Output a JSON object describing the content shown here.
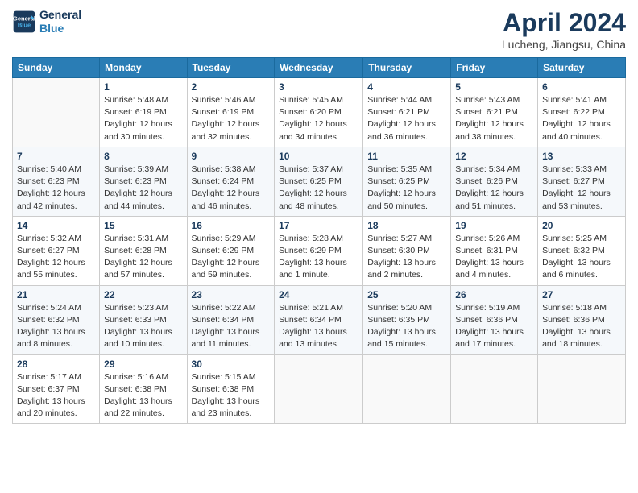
{
  "header": {
    "logo_line1": "General",
    "logo_line2": "Blue",
    "title": "April 2024",
    "subtitle": "Lucheng, Jiangsu, China"
  },
  "columns": [
    "Sunday",
    "Monday",
    "Tuesday",
    "Wednesday",
    "Thursday",
    "Friday",
    "Saturday"
  ],
  "weeks": [
    [
      {
        "num": "",
        "info": ""
      },
      {
        "num": "1",
        "info": "Sunrise: 5:48 AM\nSunset: 6:19 PM\nDaylight: 12 hours\nand 30 minutes."
      },
      {
        "num": "2",
        "info": "Sunrise: 5:46 AM\nSunset: 6:19 PM\nDaylight: 12 hours\nand 32 minutes."
      },
      {
        "num": "3",
        "info": "Sunrise: 5:45 AM\nSunset: 6:20 PM\nDaylight: 12 hours\nand 34 minutes."
      },
      {
        "num": "4",
        "info": "Sunrise: 5:44 AM\nSunset: 6:21 PM\nDaylight: 12 hours\nand 36 minutes."
      },
      {
        "num": "5",
        "info": "Sunrise: 5:43 AM\nSunset: 6:21 PM\nDaylight: 12 hours\nand 38 minutes."
      },
      {
        "num": "6",
        "info": "Sunrise: 5:41 AM\nSunset: 6:22 PM\nDaylight: 12 hours\nand 40 minutes."
      }
    ],
    [
      {
        "num": "7",
        "info": "Sunrise: 5:40 AM\nSunset: 6:23 PM\nDaylight: 12 hours\nand 42 minutes."
      },
      {
        "num": "8",
        "info": "Sunrise: 5:39 AM\nSunset: 6:23 PM\nDaylight: 12 hours\nand 44 minutes."
      },
      {
        "num": "9",
        "info": "Sunrise: 5:38 AM\nSunset: 6:24 PM\nDaylight: 12 hours\nand 46 minutes."
      },
      {
        "num": "10",
        "info": "Sunrise: 5:37 AM\nSunset: 6:25 PM\nDaylight: 12 hours\nand 48 minutes."
      },
      {
        "num": "11",
        "info": "Sunrise: 5:35 AM\nSunset: 6:25 PM\nDaylight: 12 hours\nand 50 minutes."
      },
      {
        "num": "12",
        "info": "Sunrise: 5:34 AM\nSunset: 6:26 PM\nDaylight: 12 hours\nand 51 minutes."
      },
      {
        "num": "13",
        "info": "Sunrise: 5:33 AM\nSunset: 6:27 PM\nDaylight: 12 hours\nand 53 minutes."
      }
    ],
    [
      {
        "num": "14",
        "info": "Sunrise: 5:32 AM\nSunset: 6:27 PM\nDaylight: 12 hours\nand 55 minutes."
      },
      {
        "num": "15",
        "info": "Sunrise: 5:31 AM\nSunset: 6:28 PM\nDaylight: 12 hours\nand 57 minutes."
      },
      {
        "num": "16",
        "info": "Sunrise: 5:29 AM\nSunset: 6:29 PM\nDaylight: 12 hours\nand 59 minutes."
      },
      {
        "num": "17",
        "info": "Sunrise: 5:28 AM\nSunset: 6:29 PM\nDaylight: 13 hours\nand 1 minute."
      },
      {
        "num": "18",
        "info": "Sunrise: 5:27 AM\nSunset: 6:30 PM\nDaylight: 13 hours\nand 2 minutes."
      },
      {
        "num": "19",
        "info": "Sunrise: 5:26 AM\nSunset: 6:31 PM\nDaylight: 13 hours\nand 4 minutes."
      },
      {
        "num": "20",
        "info": "Sunrise: 5:25 AM\nSunset: 6:32 PM\nDaylight: 13 hours\nand 6 minutes."
      }
    ],
    [
      {
        "num": "21",
        "info": "Sunrise: 5:24 AM\nSunset: 6:32 PM\nDaylight: 13 hours\nand 8 minutes."
      },
      {
        "num": "22",
        "info": "Sunrise: 5:23 AM\nSunset: 6:33 PM\nDaylight: 13 hours\nand 10 minutes."
      },
      {
        "num": "23",
        "info": "Sunrise: 5:22 AM\nSunset: 6:34 PM\nDaylight: 13 hours\nand 11 minutes."
      },
      {
        "num": "24",
        "info": "Sunrise: 5:21 AM\nSunset: 6:34 PM\nDaylight: 13 hours\nand 13 minutes."
      },
      {
        "num": "25",
        "info": "Sunrise: 5:20 AM\nSunset: 6:35 PM\nDaylight: 13 hours\nand 15 minutes."
      },
      {
        "num": "26",
        "info": "Sunrise: 5:19 AM\nSunset: 6:36 PM\nDaylight: 13 hours\nand 17 minutes."
      },
      {
        "num": "27",
        "info": "Sunrise: 5:18 AM\nSunset: 6:36 PM\nDaylight: 13 hours\nand 18 minutes."
      }
    ],
    [
      {
        "num": "28",
        "info": "Sunrise: 5:17 AM\nSunset: 6:37 PM\nDaylight: 13 hours\nand 20 minutes."
      },
      {
        "num": "29",
        "info": "Sunrise: 5:16 AM\nSunset: 6:38 PM\nDaylight: 13 hours\nand 22 minutes."
      },
      {
        "num": "30",
        "info": "Sunrise: 5:15 AM\nSunset: 6:38 PM\nDaylight: 13 hours\nand 23 minutes."
      },
      {
        "num": "",
        "info": ""
      },
      {
        "num": "",
        "info": ""
      },
      {
        "num": "",
        "info": ""
      },
      {
        "num": "",
        "info": ""
      }
    ]
  ]
}
